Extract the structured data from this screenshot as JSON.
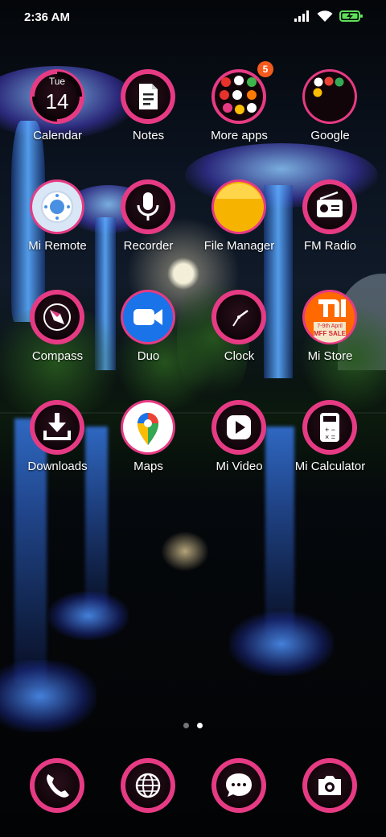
{
  "status_bar": {
    "time": "2:36 AM",
    "icons": [
      "signal-icon",
      "wifi-icon",
      "battery-charging-icon"
    ]
  },
  "colors": {
    "ring_pink": "#e63b84",
    "ring_dark": "#1a0810",
    "badge_orange": "#f45a1d",
    "duo_blue": "#1a73e8",
    "file_yellow": "#f6b400",
    "mi_orange": "#ff6900"
  },
  "apps": {
    "calendar": {
      "label": "Calendar",
      "day": "Tue",
      "date": "14"
    },
    "notes": {
      "label": "Notes"
    },
    "more_apps": {
      "label": "More apps",
      "badge": "5"
    },
    "google": {
      "label": "Google"
    },
    "mi_remote": {
      "label": "Mi Remote"
    },
    "recorder": {
      "label": "Recorder"
    },
    "file_manager": {
      "label": "File Manager"
    },
    "fm_radio": {
      "label": "FM Radio"
    },
    "compass": {
      "label": "Compass"
    },
    "duo": {
      "label": "Duo"
    },
    "clock": {
      "label": "Clock"
    },
    "mi_store": {
      "label": "Mi Store",
      "promo": "7-9th April",
      "promo2": "MFF SALE"
    },
    "downloads": {
      "label": "Downloads"
    },
    "maps": {
      "label": "Maps"
    },
    "mi_video": {
      "label": "Mi Video"
    },
    "mi_calculator": {
      "label": "Mi Calculator"
    }
  },
  "page_indicator": {
    "pages": 2,
    "current": 2
  },
  "dock": {
    "items": [
      "phone-icon",
      "browser-icon",
      "messages-icon",
      "camera-icon"
    ]
  }
}
